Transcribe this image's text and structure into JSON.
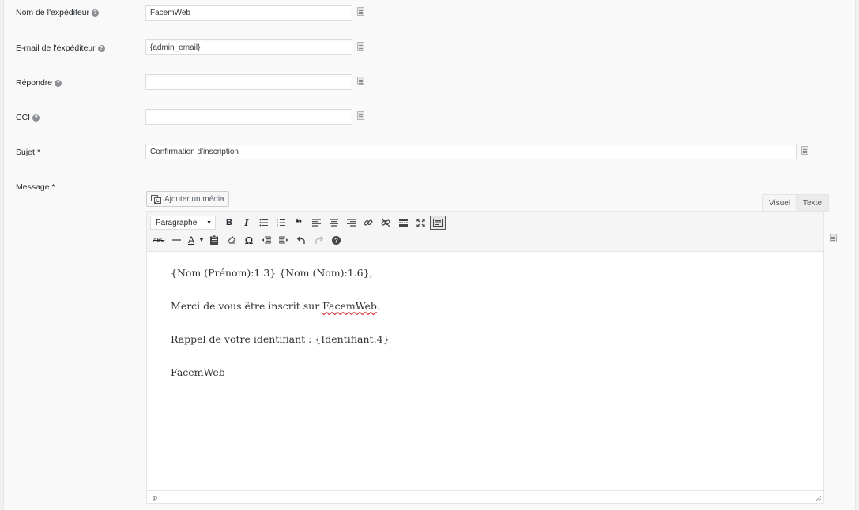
{
  "fields": {
    "sender_name": {
      "label": "Nom de l'expéditeur",
      "value": "FacemWeb"
    },
    "sender_email": {
      "label": "E-mail de l'expéditeur",
      "value": "{admin_email}"
    },
    "reply_to": {
      "label": "Répondre",
      "value": ""
    },
    "bcc": {
      "label": "CCI",
      "value": ""
    },
    "subject": {
      "label": "Sujet",
      "required_mark": "*",
      "value": "Confirmation d'inscription"
    },
    "message": {
      "label": "Message",
      "required_mark": "*"
    }
  },
  "editor": {
    "add_media_label": "Ajouter un média",
    "tab_visual": "Visuel",
    "tab_text": "Texte",
    "format_select": "Paragraphe",
    "content": {
      "line1": "{Nom (Prénom):1.3} {Nom (Nom):1.6},",
      "line2_before": "Merci de vous être inscrit sur ",
      "line2_word": "FacemWeb",
      "line2_after": ".",
      "line3": "Rappel de votre identifiant : {Identifiant:4}",
      "line4": "FacemWeb"
    },
    "status_path": "p"
  },
  "icons": {
    "help": "question-circle-icon",
    "merge_tags": "merge-tag-list-icon"
  }
}
